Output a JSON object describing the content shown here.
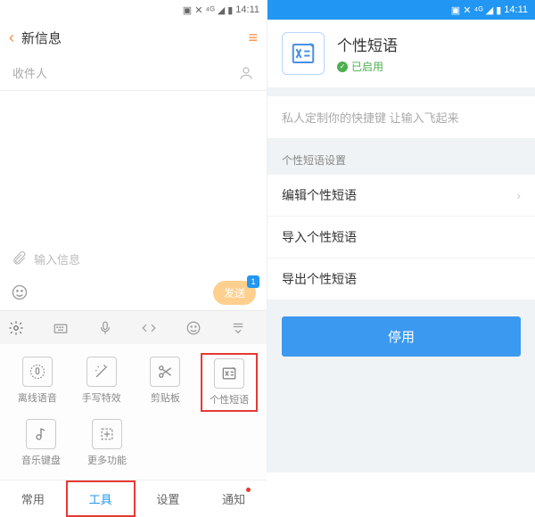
{
  "status": {
    "time": "14:11",
    "icons": "⚡ ✕ ⁴ᴳ ▫ ▪"
  },
  "left": {
    "title": "新信息",
    "recipient_label": "收件人",
    "input_placeholder": "输入信息",
    "send_label": "发送",
    "send_badge": "1",
    "tools": [
      {
        "label": "离线语音",
        "icon": "voice"
      },
      {
        "label": "手写特效",
        "icon": "wand"
      },
      {
        "label": "剪贴板",
        "icon": "clip"
      },
      {
        "label": "个性短语",
        "icon": "phrase",
        "highlighted": true
      },
      {
        "label": "音乐键盘",
        "icon": "music"
      },
      {
        "label": "更多功能",
        "icon": "more"
      }
    ],
    "tabs": [
      "常用",
      "工具",
      "设置",
      "通知"
    ],
    "active_tab": 1
  },
  "right": {
    "feature_title": "个性短语",
    "feature_status": "已启用",
    "promo": "私人定制你的快捷键 让输入飞起来",
    "section_label": "个性短语设置",
    "settings": [
      {
        "label": "编辑个性短语",
        "chevron": true
      },
      {
        "label": "导入个性短语",
        "chevron": false
      },
      {
        "label": "导出个性短语",
        "chevron": false
      }
    ],
    "disable_label": "停用"
  }
}
